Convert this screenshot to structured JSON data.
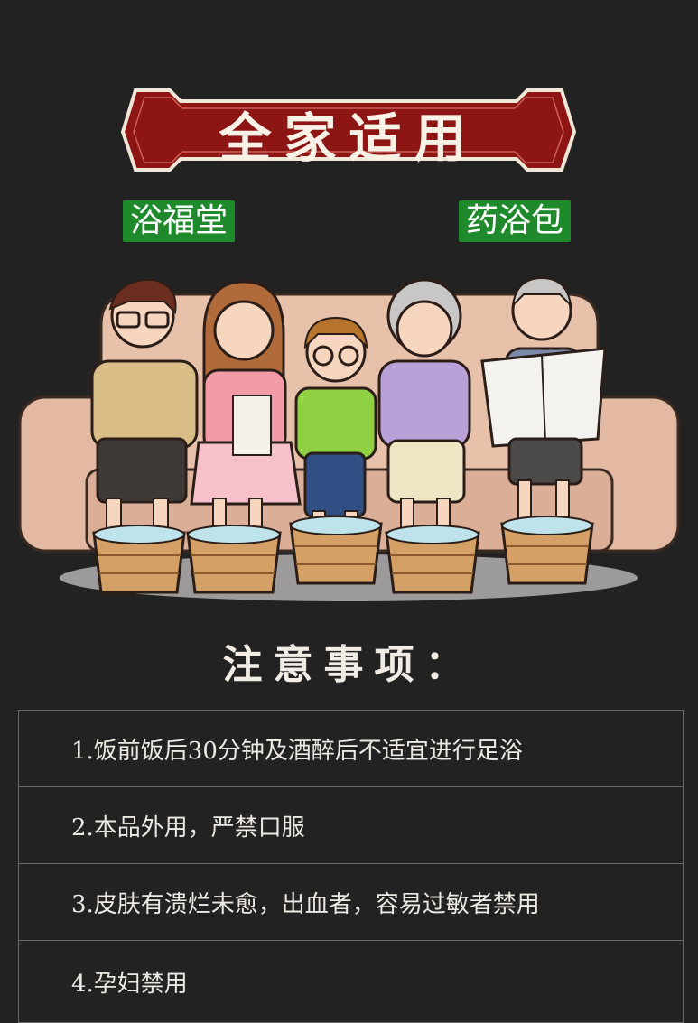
{
  "header": {
    "title": "全家适用"
  },
  "tags": {
    "left": "浴福堂",
    "right": "药浴包"
  },
  "notice": {
    "title": "注意事项：",
    "items": [
      "1.饭前饭后30分钟及酒醉后不适宜进行足浴",
      "2.本品外用，严禁口服",
      "3.皮肤有溃烂未愈，出血者，容易过敏者禁用",
      "4.孕妇禁用"
    ]
  },
  "colors": {
    "background": "#232222",
    "banner": "#8d1514",
    "banner_border": "#f0e6d8",
    "tag": "#1f8a2c",
    "sofa": "#e3b9a3"
  }
}
